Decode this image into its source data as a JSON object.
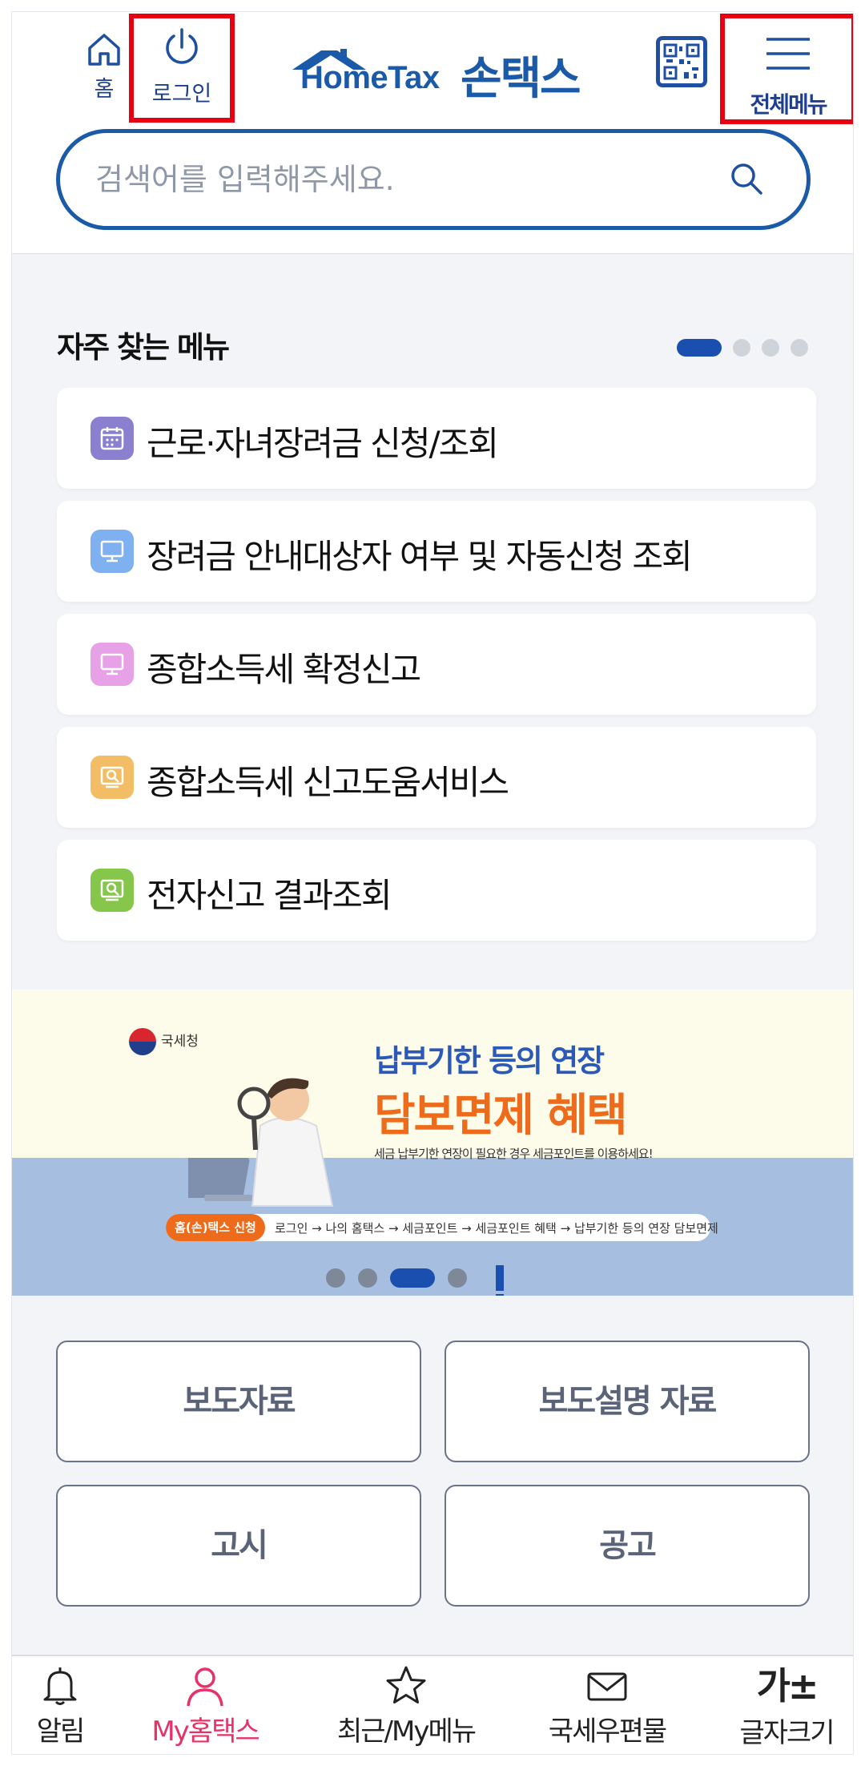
{
  "header": {
    "home_label": "홈",
    "login_label": "로그인",
    "logo_en": "HomeTax",
    "logo_ko": "손택스",
    "menu_label": "전체메뉴",
    "brand_color": "#1a5aa8",
    "highlight_color": "#e60012"
  },
  "search": {
    "placeholder": "검색어를 입력해주세요."
  },
  "frequent": {
    "title": "자주 찾는 메뉴",
    "page_count": 4,
    "active_page": 1,
    "items": [
      {
        "label": "근로·자녀장려금 신청/조회",
        "icon": "calendar-icon",
        "color": "#8b7fd0"
      },
      {
        "label": "장려금 안내대상자 여부 및 자동신청 조회",
        "icon": "monitor-icon",
        "color": "#7fb0ef"
      },
      {
        "label": "종합소득세 확정신고",
        "icon": "monitor-icon",
        "color": "#e7a1e6"
      },
      {
        "label": "종합소득세 신고도움서비스",
        "icon": "search-document-icon",
        "color": "#f3bd66"
      },
      {
        "label": "전자신고 결과조회",
        "icon": "search-document-icon",
        "color": "#86c64a"
      }
    ]
  },
  "banner": {
    "agency": "국세청",
    "headline": "납부기한 등의 연장",
    "title": "담보면제 혜택",
    "subtitle": "세금 납부기한 연장이 필요한 경우 세금포인트를 이용하세요!",
    "step_tag": "홈(손)택스 신청",
    "steps": "로그인 → 나의 홈택스 → 세금포인트 → 세금포인트 혜택 → 납부기한 등의 연장 담보면제",
    "slide_count": 4,
    "active_slide": 3
  },
  "links": [
    "보도자료",
    "보도설명 자료",
    "고시",
    "공고"
  ],
  "bottom_nav": [
    {
      "label": "알림",
      "icon": "bell-icon",
      "active": false
    },
    {
      "label": "My홈택스",
      "icon": "person-icon",
      "active": true
    },
    {
      "label": "최근/My메뉴",
      "icon": "star-icon",
      "active": false
    },
    {
      "label": "국세우편물",
      "icon": "mail-icon",
      "active": false
    },
    {
      "label": "글자크기",
      "icon": "text-size-icon",
      "glyph": "가±",
      "active": false
    }
  ]
}
